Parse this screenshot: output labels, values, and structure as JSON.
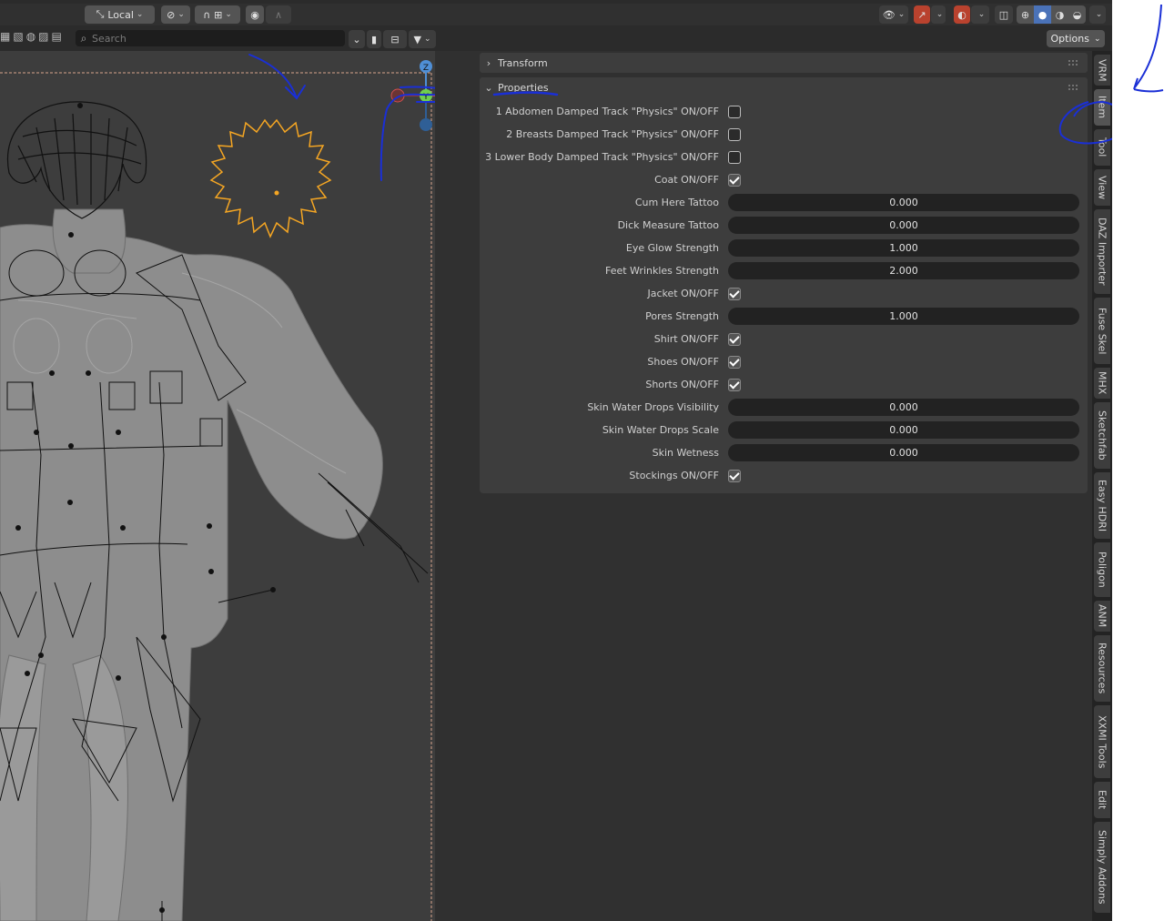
{
  "header": {
    "transform_orientation": "Local",
    "options_label": "Options"
  },
  "search": {
    "placeholder": "Search"
  },
  "gizmo": {
    "x": "X",
    "y": "Y",
    "z": "Z"
  },
  "panels": {
    "transform": {
      "label": "Transform",
      "expanded": false
    },
    "properties": {
      "label": "Properties",
      "expanded": true
    }
  },
  "properties": [
    {
      "label": "1 Abdomen Damped Track \"Physics\" ON/OFF",
      "type": "checkbox",
      "checked": false
    },
    {
      "label": "2 Breasts Damped Track \"Physics\" ON/OFF",
      "type": "checkbox",
      "checked": false
    },
    {
      "label": "3 Lower Body Damped Track \"Physics\" ON/OFF",
      "type": "checkbox",
      "checked": false
    },
    {
      "label": "Coat ON/OFF",
      "type": "checkbox",
      "checked": true
    },
    {
      "label": "Cum Here Tattoo",
      "type": "number",
      "value": "0.000"
    },
    {
      "label": "Dick Measure Tattoo",
      "type": "number",
      "value": "0.000"
    },
    {
      "label": "Eye Glow Strength",
      "type": "number",
      "value": "1.000"
    },
    {
      "label": "Feet Wrinkles Strength",
      "type": "number",
      "value": "2.000"
    },
    {
      "label": "Jacket ON/OFF",
      "type": "checkbox",
      "checked": true
    },
    {
      "label": "Pores Strength",
      "type": "number",
      "value": "1.000"
    },
    {
      "label": "Shirt ON/OFF",
      "type": "checkbox",
      "checked": true
    },
    {
      "label": "Shoes ON/OFF",
      "type": "checkbox",
      "checked": true
    },
    {
      "label": "Shorts ON/OFF",
      "type": "checkbox",
      "checked": true
    },
    {
      "label": "Skin  Water Drops Visibility",
      "type": "number",
      "value": "0.000"
    },
    {
      "label": "Skin Water Drops Scale",
      "type": "number",
      "value": "0.000"
    },
    {
      "label": "Skin Wetness",
      "type": "number",
      "value": "0.000"
    },
    {
      "label": "Stockings ON/OFF",
      "type": "checkbox",
      "checked": true
    }
  ],
  "tabs": [
    {
      "label": "VRM",
      "active": false
    },
    {
      "label": "Item",
      "active": true
    },
    {
      "label": "Tool",
      "active": false
    },
    {
      "label": "View",
      "active": false
    },
    {
      "label": "DAZ Importer",
      "active": false
    },
    {
      "label": "Fuse Skel",
      "active": false
    },
    {
      "label": "MHX",
      "active": false
    },
    {
      "label": "Sketchfab",
      "active": false
    },
    {
      "label": "Easy HDRI",
      "active": false
    },
    {
      "label": "Poligon",
      "active": false
    },
    {
      "label": "ANM",
      "active": false
    },
    {
      "label": "Resources",
      "active": false
    },
    {
      "label": "XXMI Tools",
      "active": false
    },
    {
      "label": "Edit",
      "active": false
    },
    {
      "label": "Simply Addons",
      "active": false
    }
  ],
  "colors": {
    "annotation_ink": "#1a2fd6",
    "light_object": "#f5a623",
    "accent_blue": "#4a72b8"
  }
}
